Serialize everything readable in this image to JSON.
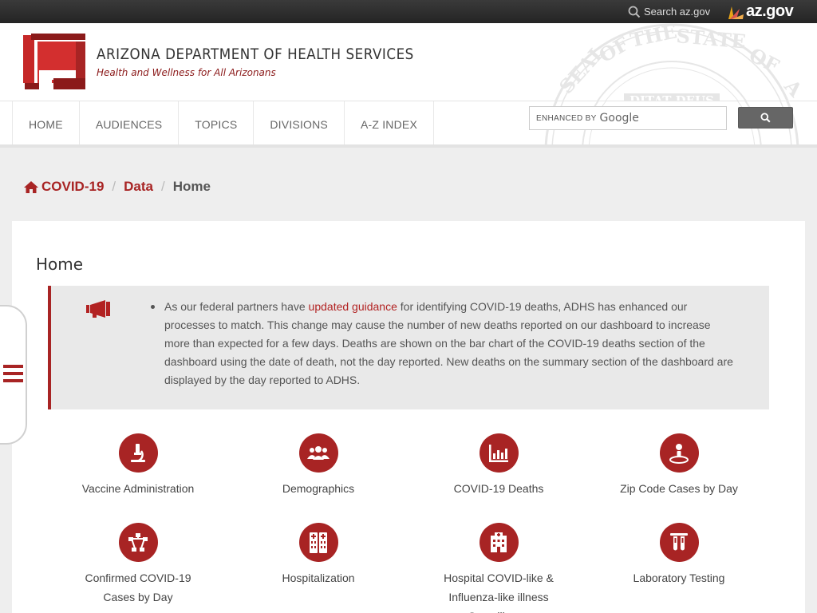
{
  "topbar": {
    "search_label": "Search az.gov",
    "azgov_label": "az.gov"
  },
  "brand": {
    "title": "ARIZONA DEPARTMENT OF HEALTH SERVICES",
    "tagline": "Health and Wellness for All Arizonans",
    "seal_text": "DITAT DEUS",
    "accent_color": "#a82424"
  },
  "nav": {
    "items": [
      {
        "label": "HOME"
      },
      {
        "label": "AUDIENCES"
      },
      {
        "label": "TOPICS"
      },
      {
        "label": "DIVISIONS"
      },
      {
        "label": "A-Z INDEX"
      }
    ],
    "search_placeholder": "ENHANCED BY",
    "search_brand": "Google",
    "search_button_icon": "search-icon"
  },
  "breadcrumb": {
    "items": [
      {
        "label": "COVID-19",
        "icon": "home-icon"
      },
      {
        "label": "Data"
      }
    ],
    "current": "Home"
  },
  "main": {
    "title": "Home",
    "alert": {
      "icon": "megaphone-icon",
      "text_before": "As our federal partners have ",
      "link_text": "updated guidance",
      "text_after": " for identifying COVID-19 deaths, ADHS has enhanced our processes to match. This change may cause the number of new deaths reported on our dashboard to increase more than expected for a few days. Deaths are shown on the bar chart of the COVID-19 deaths section of the dashboard using the date of death, not the day reported. New deaths on the summary section of the dashboard are displayed by the day reported to ADHS."
    },
    "tiles": [
      {
        "label": "Vaccine Administration",
        "icon": "microscope-icon"
      },
      {
        "label": "Demographics",
        "icon": "people-icon"
      },
      {
        "label": "COVID-19 Deaths",
        "icon": "bar-chart-icon"
      },
      {
        "label": "Zip Code Cases by Day",
        "icon": "map-pin-icon"
      },
      {
        "label": "Confirmed COVID-19 Cases by Day",
        "icon": "network-icon"
      },
      {
        "label": "Hospitalization",
        "icon": "hospital-beds-icon"
      },
      {
        "label": "Hospital COVID-like & Influenza-like illness Surveillance",
        "icon": "hospital-building-icon"
      },
      {
        "label": "Laboratory Testing",
        "icon": "test-tubes-icon"
      }
    ]
  },
  "side_menu": {
    "icon": "menu-icon"
  }
}
